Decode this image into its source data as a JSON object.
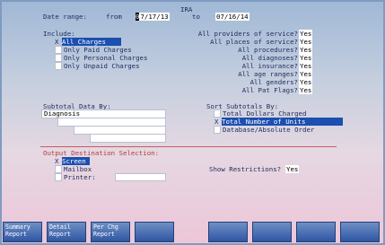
{
  "title": "IRA",
  "date_range": {
    "label": "Date range:",
    "from_label": "from",
    "from_cursor": "0",
    "from_rest": "7/17/13",
    "to_label": "to",
    "to_value": "07/16/14"
  },
  "include": {
    "label": "Include:",
    "options": [
      {
        "mark": "X",
        "label": "All Charges"
      },
      {
        "mark": "",
        "label": "Only Paid Charges"
      },
      {
        "mark": "",
        "label": "Only Personal Charges"
      },
      {
        "mark": "",
        "label": "Only Unpaid Charges"
      }
    ]
  },
  "filters": [
    {
      "label": "All providers of service?",
      "value": "Yes"
    },
    {
      "label": "All places of service?",
      "value": "Yes"
    },
    {
      "label": "All procedures?",
      "value": "Yes"
    },
    {
      "label": "All diagnoses?",
      "value": "Yes"
    },
    {
      "label": "All insurance?",
      "value": "Yes"
    },
    {
      "label": "All age ranges?",
      "value": "Yes"
    },
    {
      "label": "All genders?",
      "value": "Yes"
    },
    {
      "label": "All Pat Flags?",
      "value": "Yes"
    }
  ],
  "subtotal": {
    "label": "Subtotal Data By:",
    "first_value": "Diagnosis"
  },
  "sort": {
    "label": "Sort Subtotals By:",
    "options": [
      {
        "mark": "",
        "label": "Total Dollars Charged"
      },
      {
        "mark": "X",
        "label": "Total Number of Units"
      },
      {
        "mark": "",
        "label": "Database/Absolute Order"
      }
    ]
  },
  "output": {
    "label": "Output Destination Selection:",
    "options": [
      {
        "mark": "X",
        "label": "Screen"
      },
      {
        "mark": "",
        "label": "Mailbox"
      },
      {
        "mark": "",
        "label": "Printer:"
      }
    ],
    "restrictions_label": "Show Restrictions?",
    "restrictions_value": "Yes"
  },
  "function_keys": [
    {
      "line1": "Summary",
      "line2": "Report"
    },
    {
      "line1": "Detail",
      "line2": "Report"
    },
    {
      "line1": "Per Chg",
      "line2": "Report"
    },
    {
      "line1": "",
      "line2": ""
    },
    {
      "line1": "",
      "line2": ""
    },
    {
      "line1": "",
      "line2": ""
    },
    {
      "line1": "",
      "line2": ""
    },
    {
      "line1": "",
      "line2": ""
    }
  ]
}
